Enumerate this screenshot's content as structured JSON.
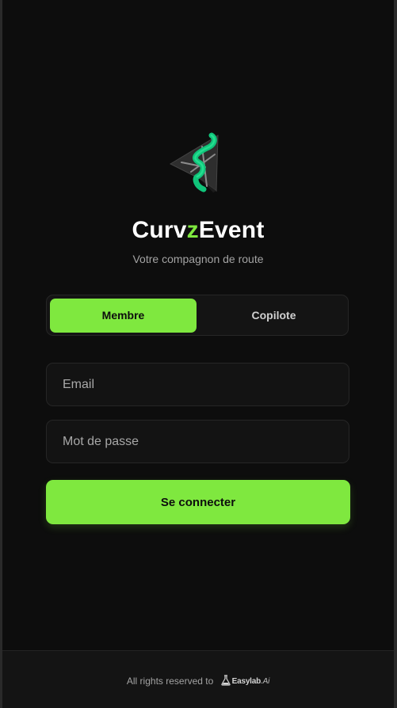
{
  "brand": {
    "name_part1": "Curv",
    "name_accent": "z",
    "name_part2": "Event",
    "tagline": "Votre compagnon de route",
    "accent_color": "#7fe83f",
    "logo_icon": "curvz-route-logo-icon"
  },
  "role_toggle": {
    "options": [
      "Membre",
      "Copilote"
    ],
    "selected": "Membre"
  },
  "form": {
    "email_placeholder": "Email",
    "password_placeholder": "Mot de passe",
    "submit_label": "Se connecter"
  },
  "footer": {
    "text": "All rights reserved to",
    "partner_name": "Easylab",
    "partner_suffix": ".Ai",
    "partner_icon": "flask-icon"
  }
}
